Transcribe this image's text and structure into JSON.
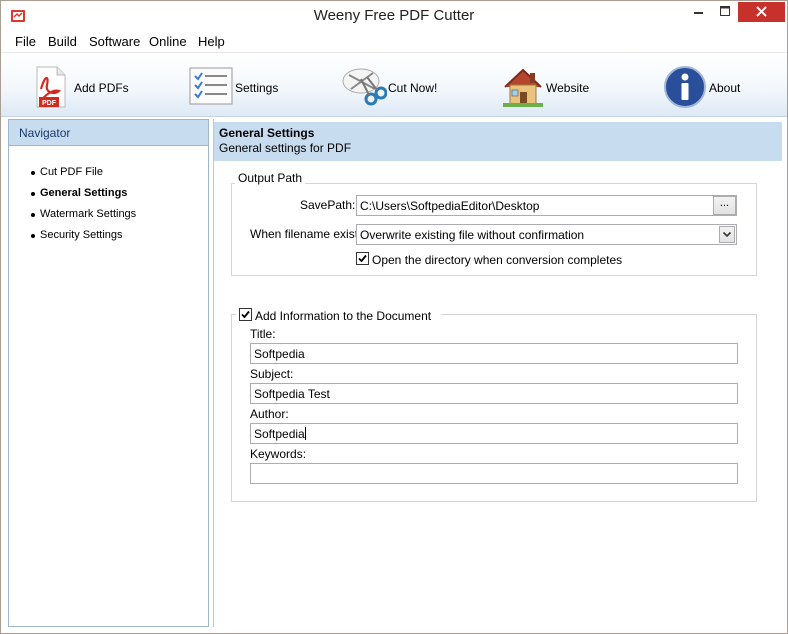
{
  "window": {
    "title": "Weeny Free PDF Cutter"
  },
  "menu": [
    "File",
    "Build",
    "Software",
    "Online",
    "Help"
  ],
  "toolbar": {
    "add_pdfs": "Add PDFs",
    "settings": "Settings",
    "cut_now": "Cut Now!",
    "website": "Website",
    "about": "About"
  },
  "navigator": {
    "title": "Navigator",
    "items": [
      "Cut PDF File",
      "General Settings",
      "Watermark Settings",
      "Security Settings"
    ],
    "active": "General Settings"
  },
  "panel": {
    "title": "General Settings",
    "subtitle": "General settings for PDF"
  },
  "output_path": {
    "legend": "Output Path",
    "savepath_label": "SavePath:",
    "savepath_value": "C:\\Users\\SoftpediaEditor\\Desktop",
    "browse_label": "...",
    "exist_label": "When filename exist:",
    "exist_value": "Overwrite existing file without confirmation",
    "open_dir_label": "Open the directory when conversion completes",
    "open_dir_checked": true
  },
  "doc_info": {
    "legend": "Add Information to the Document",
    "enabled": true,
    "title_label": "Title:",
    "title_value": "Softpedia",
    "subject_label": "Subject:",
    "subject_value": "Softpedia Test",
    "author_label": "Author:",
    "author_value": "Softpedia",
    "keywords_label": "Keywords:",
    "keywords_value": ""
  },
  "colors": {
    "header_bg": "#c8dcf0",
    "close_button": "#c7312b"
  }
}
